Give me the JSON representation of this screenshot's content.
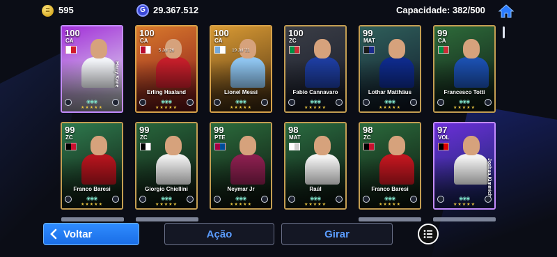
{
  "header": {
    "coins_value": "595",
    "gp_icon_letter": "G",
    "gp_value": "29.367.512",
    "capacity_text": "Capacidade: 382/500"
  },
  "cards": [
    {
      "rating": "100",
      "position": "CA",
      "name": "Harry Kane",
      "flag": [
        "#ffffff",
        "#d11b2b"
      ],
      "bg": [
        "#a230d8",
        "#e2e6ef"
      ],
      "kit": "#f1f3f7",
      "border": "#c48cff",
      "vertical_name": true
    },
    {
      "rating": "100",
      "position": "CA",
      "name": "Erling Haaland",
      "flag": [
        "#ba0c2f",
        "#ffffff"
      ],
      "bg": [
        "#d97a2c",
        "#8b1d1d"
      ],
      "kit": "#c41e2a",
      "border": "#d7a24a",
      "date": "5 Jul '26"
    },
    {
      "rating": "100",
      "position": "CA",
      "name": "Lionel Messi",
      "flag": [
        "#75aadb",
        "#ffffff"
      ],
      "bg": [
        "#d99a34",
        "#5a3c16"
      ],
      "kit": "#8ec4ef",
      "border": "#d7a24a",
      "date": "19 Jul '21"
    },
    {
      "rating": "100",
      "position": "ZC",
      "name": "Fabio Cannavaro",
      "flag": [
        "#009246",
        "#ce2b37"
      ],
      "bg": [
        "#3b3e46",
        "#1a1e2c"
      ],
      "kit": "#1d3c9e",
      "border": "#c49e52"
    },
    {
      "rating": "99",
      "position": "MAT",
      "name": "Lothar Matthäus",
      "flag": [
        "#1a1a1a",
        "#1a2b8c"
      ],
      "bg": [
        "#2f5f5a",
        "#142030"
      ],
      "kit": "#0e2a8a",
      "border": "#c49e52"
    },
    {
      "rating": "99",
      "position": "CA",
      "name": "Francesco Totti",
      "flag": [
        "#009246",
        "#ce2b37"
      ],
      "bg": [
        "#2e6b3a",
        "#112018"
      ],
      "kit": "#1b4fae",
      "border": "#c49e52"
    },
    {
      "rating": "99",
      "position": "ZC",
      "name": "Franco Baresi",
      "flag": [
        "#000000",
        "#c8102e"
      ],
      "bg": [
        "#2e7a4e",
        "#122014"
      ],
      "kit": "#b3141d",
      "border": "#c49e52"
    },
    {
      "rating": "99",
      "position": "ZC",
      "name": "Giorgio Chiellini",
      "flag": [
        "#000000",
        "#ffffff"
      ],
      "bg": [
        "#28663c",
        "#0f1a12"
      ],
      "kit": "#eeeeee",
      "border": "#c49e52"
    },
    {
      "rating": "99",
      "position": "PTE",
      "name": "Neymar Jr",
      "flag": [
        "#a50044",
        "#004d98"
      ],
      "bg": [
        "#2b6b3c",
        "#101a12"
      ],
      "kit": "#8a1f4e",
      "border": "#c49e52"
    },
    {
      "rating": "98",
      "position": "MAT",
      "name": "Raúl",
      "flag": [
        "#ffffff",
        "#cfcfcf"
      ],
      "bg": [
        "#2a6b40",
        "#0f1c14"
      ],
      "kit": "#f2f2f2",
      "border": "#c49e52"
    },
    {
      "rating": "98",
      "position": "ZC",
      "name": "Franco Baresi",
      "flag": [
        "#000000",
        "#c8102e"
      ],
      "bg": [
        "#2b6a3c",
        "#0f1c12"
      ],
      "kit": "#c0161f",
      "border": "#c49e52"
    },
    {
      "rating": "97",
      "position": "VOL",
      "name": "Joshua Kimmich",
      "flag": [
        "#000000",
        "#dd0000"
      ],
      "bg": [
        "#6b2fd8",
        "#1a2a6c"
      ],
      "kit": "#f2f2f2",
      "border": "#c48cff",
      "vertical_name": true
    }
  ],
  "card_footer": {
    "skills": "◉◉◉",
    "stars": "★★★★★"
  },
  "buttons": {
    "back": "Voltar",
    "action": "Ação",
    "spin": "Girar"
  },
  "icons": {
    "coin": "coin-icon",
    "gp": "gp-icon",
    "home": "home-icon",
    "back": "chevron-left-icon",
    "list": "list-icon"
  }
}
